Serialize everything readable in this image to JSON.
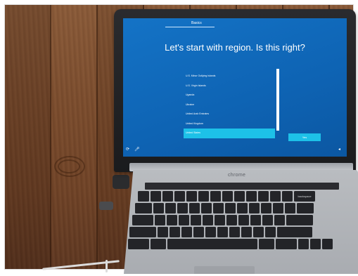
{
  "screen": {
    "tab_label": "Basics",
    "heading": "Let's start with region. Is this right?",
    "regions": [
      "U.S. Minor Outlying Islands",
      "U.S. Virgin Islands",
      "Uganda",
      "Ukraine",
      "United Arab Emirates",
      "United Kingdom",
      "United States"
    ],
    "selected_region": "United States",
    "yes_button": "Yes",
    "accent_color": "#1dc1e8",
    "background_color": "#1473c6"
  },
  "laptop": {
    "brand": "chrome",
    "backspace_key": "backspace"
  }
}
